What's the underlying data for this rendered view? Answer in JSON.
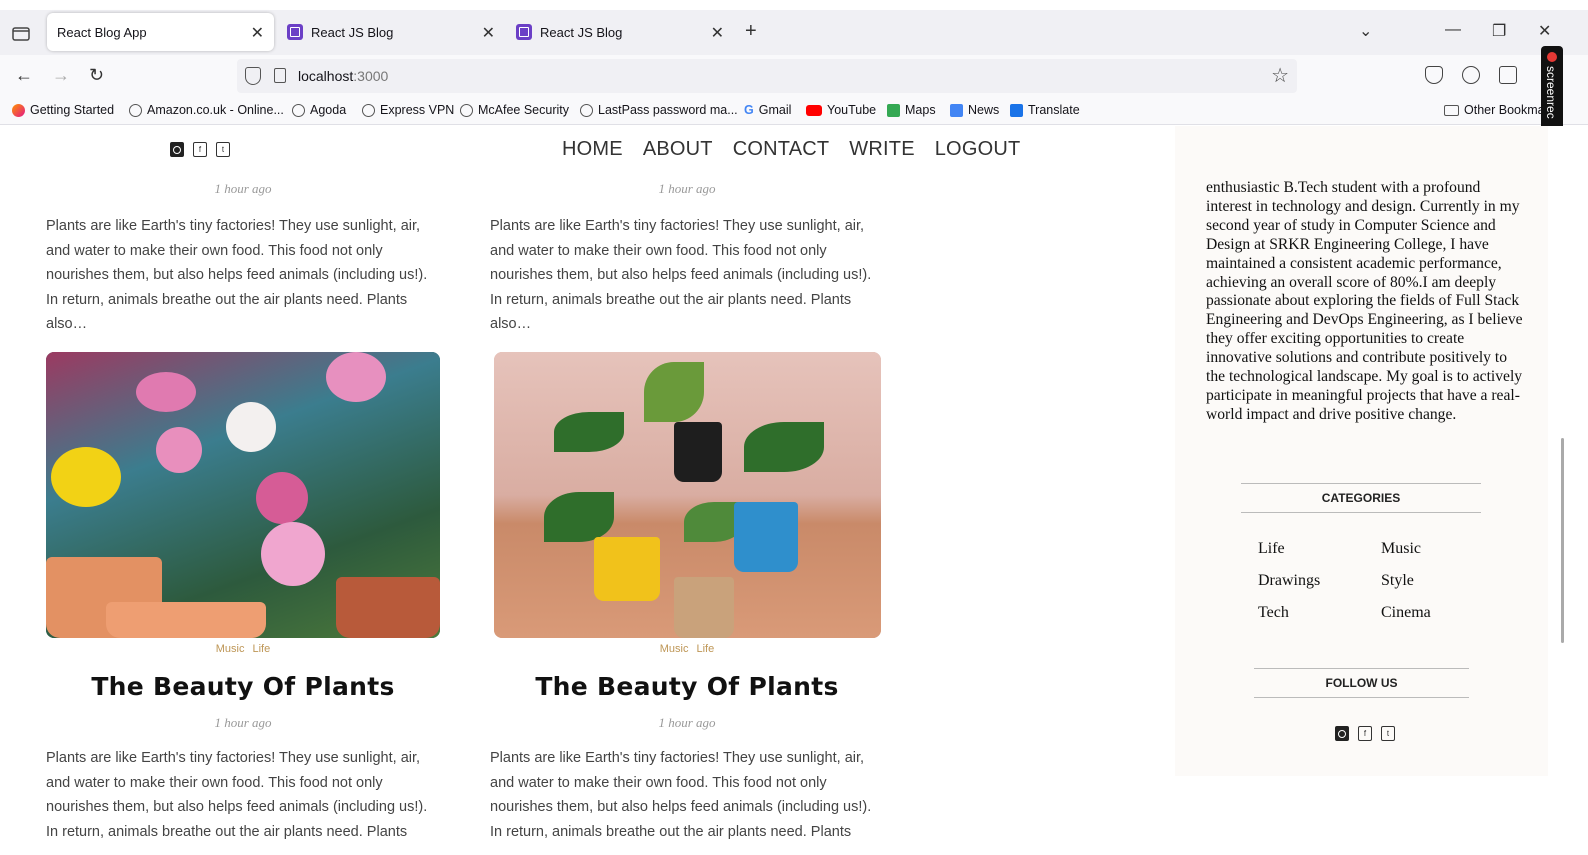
{
  "browser": {
    "tabs": [
      {
        "title": "React Blog App",
        "active": true
      },
      {
        "title": "React JS Blog",
        "active": false
      },
      {
        "title": "React JS Blog",
        "active": false
      }
    ],
    "url_host": "localhost",
    "url_port": ":3000",
    "bookmarks": [
      {
        "label": "Getting Started",
        "icon": "firefox-icon"
      },
      {
        "label": "Amazon.co.uk - Online...",
        "icon": "globe-icon"
      },
      {
        "label": "Agoda",
        "icon": "globe-icon"
      },
      {
        "label": "Express VPN",
        "icon": "globe-icon"
      },
      {
        "label": "McAfee Security",
        "icon": "globe-icon"
      },
      {
        "label": "LastPass password ma...",
        "icon": "globe-icon"
      },
      {
        "label": "Gmail",
        "icon": "google-icon"
      },
      {
        "label": "YouTube",
        "icon": "youtube-icon"
      },
      {
        "label": "Maps",
        "icon": "maps-icon"
      },
      {
        "label": "News",
        "icon": "news-icon"
      },
      {
        "label": "Translate",
        "icon": "translate-icon"
      }
    ],
    "other_bookmarks": "Other Bookma",
    "screenrec_label": "screenrec"
  },
  "site": {
    "menu": [
      "HOME",
      "ABOUT",
      "CONTACT",
      "WRITE",
      "LOGOUT"
    ],
    "social_icons": [
      "instagram-icon",
      "facebook-icon",
      "twitter-icon"
    ]
  },
  "posts_top": [
    {
      "date": "1 hour ago",
      "desc": "Plants are like Earth's tiny factories! They use sunlight, air, and water to make their own food. This food not only nourishes them, but also helps feed animals (including us!). In return, animals breathe out the air plants need. Plants also…"
    },
    {
      "date": "1 hour ago",
      "desc": "Plants are like Earth's tiny factories! They use sunlight, air, and water to make their own food. This food not only nourishes them, but also helps feed animals (including us!). In return, animals breathe out the air plants need. Plants also…"
    }
  ],
  "posts_bottom": [
    {
      "cats": [
        "Music",
        "Life"
      ],
      "title": "The Beauty Of Plants",
      "date": "1 hour ago",
      "desc": "Plants are like Earth's tiny factories! They use sunlight, air, and water to make their own food. This food not only nourishes them, but also helps feed animals (including us!). In return, animals breathe out the air plants need. Plants also…"
    },
    {
      "cats": [
        "Music",
        "Life"
      ],
      "title": "The Beauty Of Plants",
      "date": "1 hour ago",
      "desc": "Plants are like Earth's tiny factories! They use sunlight, air, and water to make their own food. This food not only nourishes them, but also helps feed animals (including us!). In return, animals breathe out the air plants need. Plants also…"
    }
  ],
  "sidebar": {
    "about_text": "enthusiastic B.Tech student with a profound interest in technology and design. Currently in my second year of study in Computer Science and Design at SRKR Engineering College, I have maintained a consistent academic performance, achieving an overall score of 80%.I am deeply passionate about exploring the fields of Full Stack Engineering and DevOps Engineering, as I believe they offer exciting opportunities to create innovative solutions and contribute positively to the technological landscape. My goal is to actively participate in meaningful projects that have a real-world impact and drive positive change.",
    "categories_title": "CATEGORIES",
    "categories": [
      "Life",
      "Music",
      "Drawings",
      "Style",
      "Tech",
      "Cinema"
    ],
    "follow_title": "FOLLOW US"
  },
  "colors": {
    "category_accent": "#be9656",
    "tab_favicon": "#6b3fc6"
  }
}
